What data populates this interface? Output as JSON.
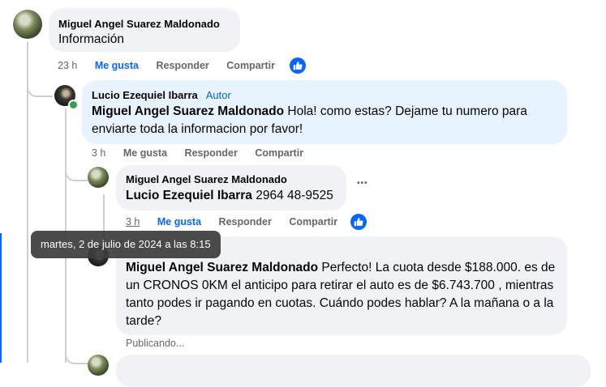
{
  "comments": [
    {
      "author": "Miguel Angel Suarez Maldonado",
      "text": "Información",
      "time": "23 h",
      "like": "Me gusta",
      "reply": "Responder",
      "share": "Compartir"
    },
    {
      "author": "Lucio Ezequiel Ibarra",
      "badge": "Autor",
      "mention": "Miguel Angel Suarez Maldonado",
      "text": " Hola! como estas? Dejame tu numero para enviarte toda la informacion por favor!",
      "time": "3 h",
      "like": "Me gusta",
      "reply": "Responder",
      "share": "Compartir"
    },
    {
      "author": "Miguel Angel Suarez Maldonado",
      "mention": "Lucio Ezequiel Ibarra",
      "text": " 2964 48-9525",
      "time": "3 h",
      "like": "Me gusta",
      "reply": "Responder",
      "share": "Compartir",
      "more": "•••"
    },
    {
      "mention": "Miguel Angel Suarez Maldonado",
      "text": " Perfecto! La cuota desde $188.000. es de un CRONOS 0KM el anticipo para retirar el auto es de $6.743.700 , mientras tanto podes ir pagando en cuotas. Cuándo podes hablar? A la mañana o a la tarde?",
      "status": "Publicando..."
    }
  ],
  "tooltip": "martes, 2 de julio de 2024 a las 8:15",
  "colors": {
    "like_blue": "#0866ff",
    "author_blue": "#0064d1",
    "bubble_gray": "#f0f2f5",
    "bubble_blue": "#e7f3ff",
    "meta_gray": "#65676b"
  }
}
